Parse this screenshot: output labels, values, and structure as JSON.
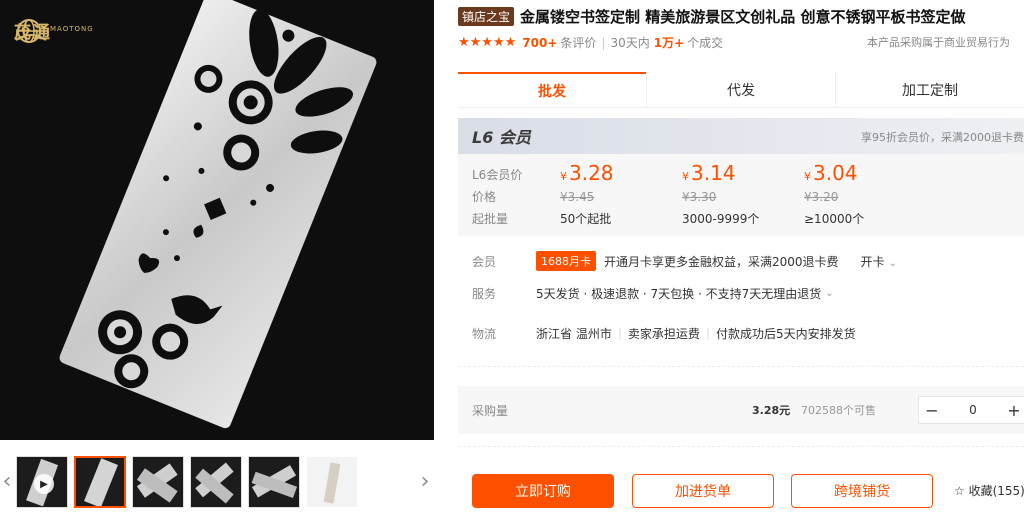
{
  "gallery": {
    "logo": {
      "name": "茂通",
      "sub": "MAOTONG"
    },
    "thumbnails": [
      {
        "kind": "video",
        "active": false
      },
      {
        "kind": "image",
        "active": true
      },
      {
        "kind": "image",
        "active": false
      },
      {
        "kind": "image",
        "active": false
      },
      {
        "kind": "image",
        "active": false
      },
      {
        "kind": "image",
        "active": false
      }
    ],
    "prev_icon": "‹",
    "next_icon": "›"
  },
  "product": {
    "shop_badge": "镇店之宝",
    "title": "金属镂空书签定制 精美旅游景区文创礼品 创意不锈钢平板书签定做",
    "stars": "★★★★★",
    "rating": 5,
    "reviews_count": "700+",
    "reviews_label": "条评价",
    "sales_period": "30天内",
    "sales_count": "1万+",
    "sales_label": "个成交",
    "trade_note": "本产品采购属于商业贸易行为"
  },
  "tabs": [
    {
      "label": "批发",
      "active": true
    },
    {
      "label": "代发",
      "active": false
    },
    {
      "label": "加工定制",
      "active": false
    }
  ],
  "pricing": {
    "member_title": "L6 会员",
    "member_note": "享95折会员价，采满2000退卡费",
    "row_labels": [
      "L6会员价",
      "价格",
      "起批量"
    ],
    "currency": "¥",
    "tiers": [
      {
        "member_price": "3.28",
        "original_price": "¥3.45",
        "moq": "50个起批"
      },
      {
        "member_price": "3.14",
        "original_price": "¥3.30",
        "moq": "3000-9999个"
      },
      {
        "member_price": "3.04",
        "original_price": "¥3.20",
        "moq": "≥10000个"
      }
    ]
  },
  "services": {
    "member_label": "会员",
    "card_badge": "1688月卡",
    "card_text": "开通月卡享更多金融权益，采满2000退卡费",
    "open_card": "开卡",
    "service_label": "服务",
    "service_text": "5天发货 · 极速退款 · 7天包换 · 不支持7天无理由退货",
    "logistics_label": "物流",
    "logistics_origin": "浙江省 温州市",
    "logistics_fee": "卖家承担运费",
    "logistics_ship": "付款成功后5天内安排发货"
  },
  "purchase": {
    "label": "采购量",
    "unit_price": "3.28元",
    "stock": "702588个可售",
    "quantity": "0",
    "minus": "−",
    "plus": "+"
  },
  "actions": {
    "order": "立即订购",
    "add_to_list": "加进货单",
    "cross_border": "跨境铺货",
    "favorite_icon": "☆",
    "favorite": "收藏(155)"
  },
  "colors": {
    "accent": "#ff5000",
    "badge_brown": "#6b3a1e"
  }
}
